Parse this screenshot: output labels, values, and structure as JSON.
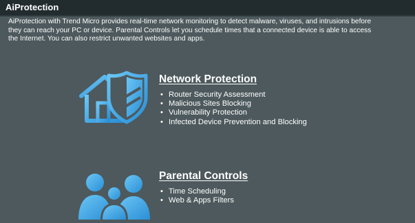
{
  "header": {
    "title": "AiProtection"
  },
  "description": "AiProtection with Trend Micro provides real-time network monitoring to detect malware, viruses, and intrusions before\nthey can reach your PC or device. Parental Controls let you schedule times that a connected device is able to access\nthe Internet. You can also restrict unwanted websites and apps.",
  "network_protection": {
    "icon": "house-shield-icon",
    "title": "Network Protection",
    "items": [
      "Router Security Assessment",
      "Malicious Sites Blocking",
      "Vulnerability Protection",
      "Infected Device Prevention and Blocking"
    ]
  },
  "parental_controls": {
    "icon": "family-icon",
    "title": "Parental Controls",
    "items": [
      "Time Scheduling",
      "Web & Apps Filters"
    ]
  },
  "colors": {
    "background": "#4d595d",
    "title_bar": "#222c2f",
    "icon_blue": "#3fa8e8",
    "text": "#ffffff"
  }
}
